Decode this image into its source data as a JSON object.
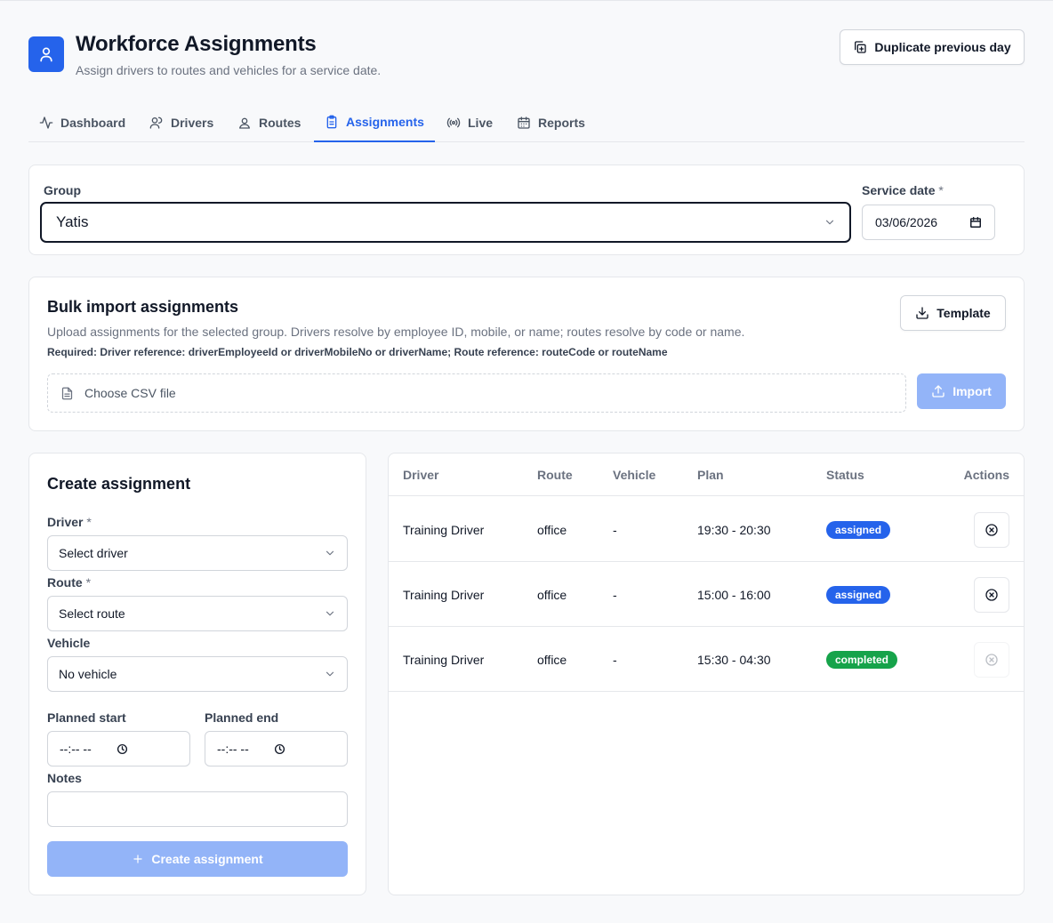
{
  "header": {
    "title": "Workforce Assignments",
    "subtitle": "Assign drivers to routes and vehicles for a service date.",
    "duplicate_label": "Duplicate previous day",
    "logo_icon": "user-icon"
  },
  "tabs": [
    {
      "label": "Dashboard",
      "icon": "activity-icon",
      "active": false
    },
    {
      "label": "Drivers",
      "icon": "users-icon",
      "active": false
    },
    {
      "label": "Routes",
      "icon": "map-pin-icon",
      "active": false
    },
    {
      "label": "Assignments",
      "icon": "clipboard-icon",
      "active": true
    },
    {
      "label": "Live",
      "icon": "radio-icon",
      "active": false
    },
    {
      "label": "Reports",
      "icon": "calendar-icon",
      "active": false
    }
  ],
  "filters": {
    "group_label": "Group",
    "group_value": "Yatis",
    "date_label": "Service date",
    "date_required": "*",
    "date_value": "03/06/2026"
  },
  "bulk": {
    "title": "Bulk import assignments",
    "description": "Upload assignments for the selected group. Drivers resolve by employee ID, mobile, or name; routes resolve by code or name.",
    "required": "Required: Driver reference: driverEmployeeId or driverMobileNo or driverName; Route reference: routeCode or routeName",
    "template_label": "Template",
    "file_label": "Choose CSV file",
    "import_label": "Import"
  },
  "create": {
    "title": "Create assignment",
    "driver_label": "Driver",
    "driver_placeholder": "Select driver",
    "route_label": "Route",
    "route_placeholder": "Select route",
    "vehicle_label": "Vehicle",
    "vehicle_value": "No vehicle",
    "start_label": "Planned start",
    "end_label": "Planned end",
    "time_placeholder": "--:-- --",
    "notes_label": "Notes",
    "required_mark": "*",
    "submit_label": "Create assignment"
  },
  "table": {
    "columns": [
      "Driver",
      "Route",
      "Vehicle",
      "Plan",
      "Status",
      "Actions"
    ],
    "rows": [
      {
        "driver": "Training Driver",
        "route": "office",
        "vehicle": "-",
        "plan": "19:30 - 20:30",
        "status": "assigned"
      },
      {
        "driver": "Training Driver",
        "route": "office",
        "vehicle": "-",
        "plan": "15:00 - 16:00",
        "status": "assigned"
      },
      {
        "driver": "Training Driver",
        "route": "office",
        "vehicle": "-",
        "plan": "15:30 - 04:30",
        "status": "completed"
      }
    ]
  },
  "colors": {
    "primary": "#2563eb",
    "primary_disabled": "#93b4f8",
    "assigned": "#2563eb",
    "completed": "#16a34a"
  }
}
